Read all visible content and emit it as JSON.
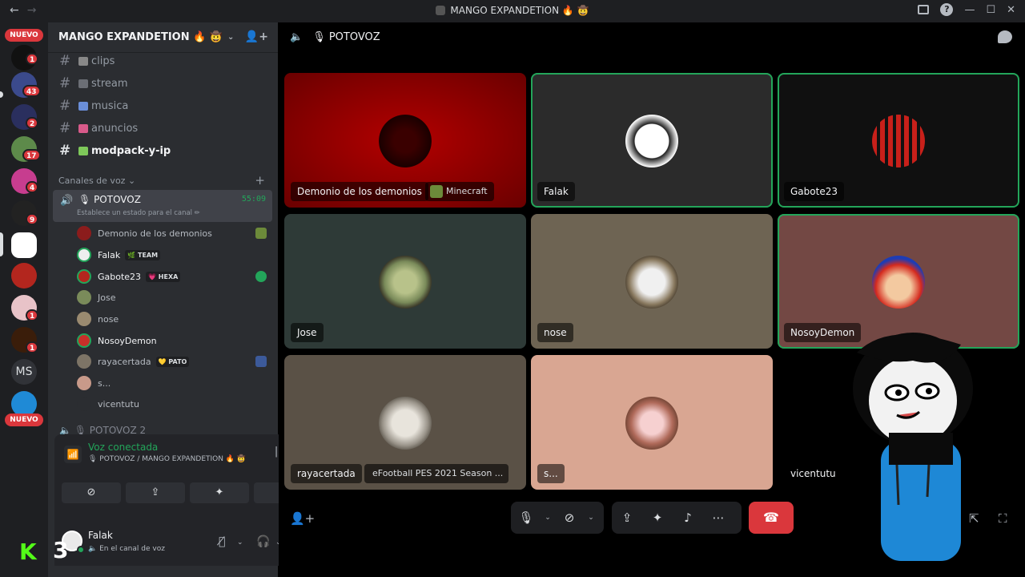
{
  "window": {
    "title": "MANGO EXPANDETION 🔥 🤠",
    "back_icon": "←",
    "forward_icon": "→",
    "help_icon": "?",
    "minimize_icon": "—",
    "maximize_icon": "☐",
    "close_icon": "✕"
  },
  "rail": {
    "nuevo_top": "NUEVO",
    "nuevo_bottom": "NUEVO",
    "ms_label": "MS",
    "badges": [
      "1",
      "43",
      "2",
      "17",
      "4",
      "9",
      "1",
      "1"
    ]
  },
  "server": {
    "name": "MANGO EXPANDETION 🔥 🤠",
    "chevron": "⌄",
    "text_channels": [
      {
        "name": "clips"
      },
      {
        "name": "stream"
      },
      {
        "name": "musica"
      },
      {
        "name": "anuncios"
      },
      {
        "name": "modpack-y-ip"
      }
    ],
    "voice_category": "Canales de voz ⌄",
    "active_voice": {
      "name": "POTOVOZ",
      "timer": "55:09",
      "status": "Establece un estado para el canal ✏"
    },
    "voice_users": [
      {
        "name": "Demonio de los demonios",
        "tag": ""
      },
      {
        "name": "Falak",
        "tag": "🌿 TEAM"
      },
      {
        "name": "Gabote23",
        "tag": "💗 HEXA"
      },
      {
        "name": "Jose",
        "tag": ""
      },
      {
        "name": "nose",
        "tag": ""
      },
      {
        "name": "NosoyDemon",
        "tag": ""
      },
      {
        "name": "rayacertada",
        "tag": "💛 PATO"
      },
      {
        "name": "s...",
        "tag": ""
      },
      {
        "name": "vicentutu",
        "tag": ""
      }
    ],
    "next_voice": "🔈 🎙 POTOVOZ 2"
  },
  "voice_panel": {
    "label": "Voz conectada",
    "sub": "🎙 POTOVOZ / MANGO EXPANDETION 🔥 🤠"
  },
  "user": {
    "name": "Falak",
    "status": "🔈 En el canal de voz"
  },
  "stream_overlay": {
    "logo_letter": "K",
    "number": "3"
  },
  "main": {
    "channel": "🎙 POTOVOZ",
    "tiles": [
      {
        "name": "Demonio de los demonios",
        "activity": "Minecraft"
      },
      {
        "name": "Falak",
        "activity": ""
      },
      {
        "name": "Gabote23",
        "activity": ""
      },
      {
        "name": "Jose",
        "activity": ""
      },
      {
        "name": "nose",
        "activity": ""
      },
      {
        "name": "NosoyDemon",
        "activity": ""
      },
      {
        "name": "rayacertada",
        "activity": "eFootball PES 2021 Season ..."
      },
      {
        "name": "s...",
        "activity": ""
      },
      {
        "name": "vicentutu",
        "activity": ""
      }
    ]
  },
  "colors": {
    "speaking": "#23a55a",
    "danger": "#da373c"
  }
}
